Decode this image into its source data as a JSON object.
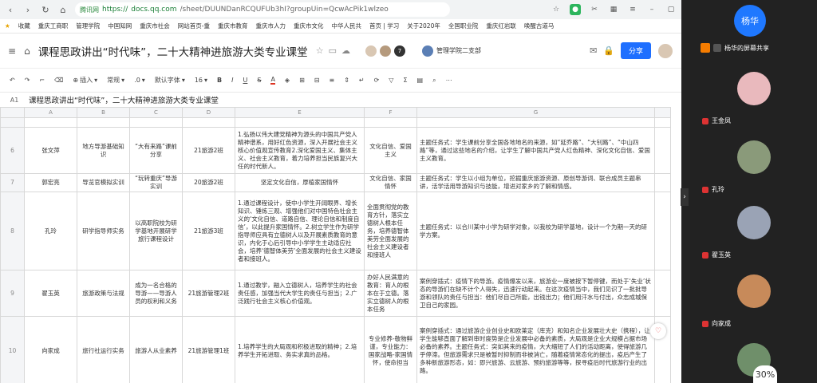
{
  "browser": {
    "url_domain": "docs.qq.com",
    "url_rest": "/sheet/DUUNDanRCQUFUb3hI?groupUin=QcwAcPik1wlzeo",
    "scheme": "https://",
    "secure_label": "腾讯网",
    "bookmarks": [
      "收藏",
      "重庆工商职",
      "管理学院",
      "中国知网",
      "重庆市社会",
      "网站首页-重",
      "重庆市教育",
      "重庆市人力",
      "重庆市文化",
      "中华人民共",
      "首页 | 学习",
      "关于2020年",
      "全国职业院",
      "重庆红岩联",
      "唤醒古道马"
    ]
  },
  "doc": {
    "title": "课程思政讲出“时代味”，二十大精神进旅游大类专业课堂",
    "avatar_count": "7",
    "org": "管理学院二支部",
    "share_label": "分享"
  },
  "toolbar": {
    "insert": "插入",
    "format": "常规",
    "decimal": ".0",
    "font": "默认字体",
    "size": "16"
  },
  "formula": {
    "cell": "A1",
    "text": "课程思政讲出“时代味”，二十大精神进旅游大类专业课堂"
  },
  "columns": [
    "A",
    "B",
    "C",
    "D",
    "E",
    "F",
    "G"
  ],
  "rows": [
    {
      "n": "6",
      "a": "张文萍",
      "b": "地方导游基础知识",
      "c": "“大有来路”课前分享",
      "d": "21旅游2班",
      "e": "1.弘扬以伟大建党精神为源头的中国共产党人精神谱系，用好红色资源，深入开展社会主义核心价值观宣传教育2.深化爱国主义、集体主义、社会主义教育，着力培养担当民族复兴大任的时代新人。",
      "f": "文化自信、爱国主义",
      "g": "主题任务式：学生课前分享全国各地地名的来源，如“延乔路”、“大钊路”、“中山四路”等，通过这些地名的介绍，让学生了解中国共产党人红色精神、深化文化自信、爱国主义教育。"
    },
    {
      "n": "7",
      "a": "郭宏亮",
      "b": "导览官模拟实训",
      "c": "“玩转重庆”导游实训",
      "d": "20旅游2班",
      "e": "坚定文化自信，厚植家国情怀",
      "f": "文化自信、家国情怀",
      "g": "主题任务式：学生以小组为单位，挖掘重庆旅游资源、原创导游词、联合成员主题串讲，活学活用导游知识与技能，增进对家乡的了解和情感。"
    },
    {
      "n": "8",
      "a": "孔玲",
      "b": "研学指导师实务",
      "c": "以高职院校为研学基地开展研学旅行课程设计",
      "d": "21旅游3班",
      "e": "1.通过课程设计，使中小学生开阔眼界、增长知识、锤炼三观、增强他们对中国特色社会主义的‘文化自信、道路自信、理论自信和制度自信’，以此提升家国情怀。2.树立学生作为研学指导师应具有立德树人以及开展素质教育的意识，内化于心后引导中小学学生主动适应社会，培养‘德智体美劳’全面发展的社会主义建设者和接班人。",
      "f": "全面贯彻党的教育方针，落实立德树人根本任务，培养德智体美劳全面发展的社会主义建设者和接班人",
      "g": "主题任务式：以合川某中小学为研学对象，以我校为研学基地，设计一个为期一天的研学方案。"
    },
    {
      "n": "9",
      "a": "翟玉英",
      "b": "旅游政策与法规",
      "c": "成为一名合格的导游——导游人员的权利和义务",
      "d": "21旅游管理2班",
      "e": "1.通过教学，融入立德树人，培养学生的社会责任感，加强当代大学生的责任与担当；2.广泛践行社会主义核心价值观。",
      "f": "办好人民满意的教育：育人的根本在于立德。落实立德树人的根本任务",
      "g": "案例穿插式：疫情下的导游。疫情爆发以来，旅游业一度被按下暂停键，而处于‘失业’状态的导游们在缺不计个人得失，迅速行动起来。在这次疫情当中，我们见识了一批批导游和领队的责任与担当：他们尽自己所能，出钱出力；他们用汗水与付出，众志成城保卫自己的家园。"
    },
    {
      "n": "10",
      "a": "向家成",
      "b": "旅行社运行实务",
      "c": "旅游人从业素养",
      "d": "21旅游管理1班",
      "e": "1.培养学生的大局观和积极进取的精神；2.培养学生开拓进取、务实求真的品格。",
      "f": "专业修养-敬物鲜谨，专业能力：国家战略-家国情怀，使命担当",
      "g": "案例穿插式：通过旅游企业创业史和欧莱定（库克）和知名企业发展壮大史（携程），让学生能够直面了解到审时度势是企业发展中必备的素质，大局观是企业大规模占据市场必备的素养。主题任务式：突如其来的疫情，大大缩短了人们的活动距离，使得旅游几乎停滞。但旅游需求只是被暂时抑制而非被消亡，随着疫情常态化的提出，疫后产生了多种新旅游形态，如：即兴旅游、云旅游、预约旅游等等，探寻疫后时代旅游行业的出路。"
    }
  ],
  "meeting": {
    "speaker": "杨华",
    "screen_share": "杨华的屏幕共享",
    "participants": [
      "王金凤",
      "孔玲",
      "翟玉英",
      "向家成"
    ],
    "progress": "30%"
  }
}
